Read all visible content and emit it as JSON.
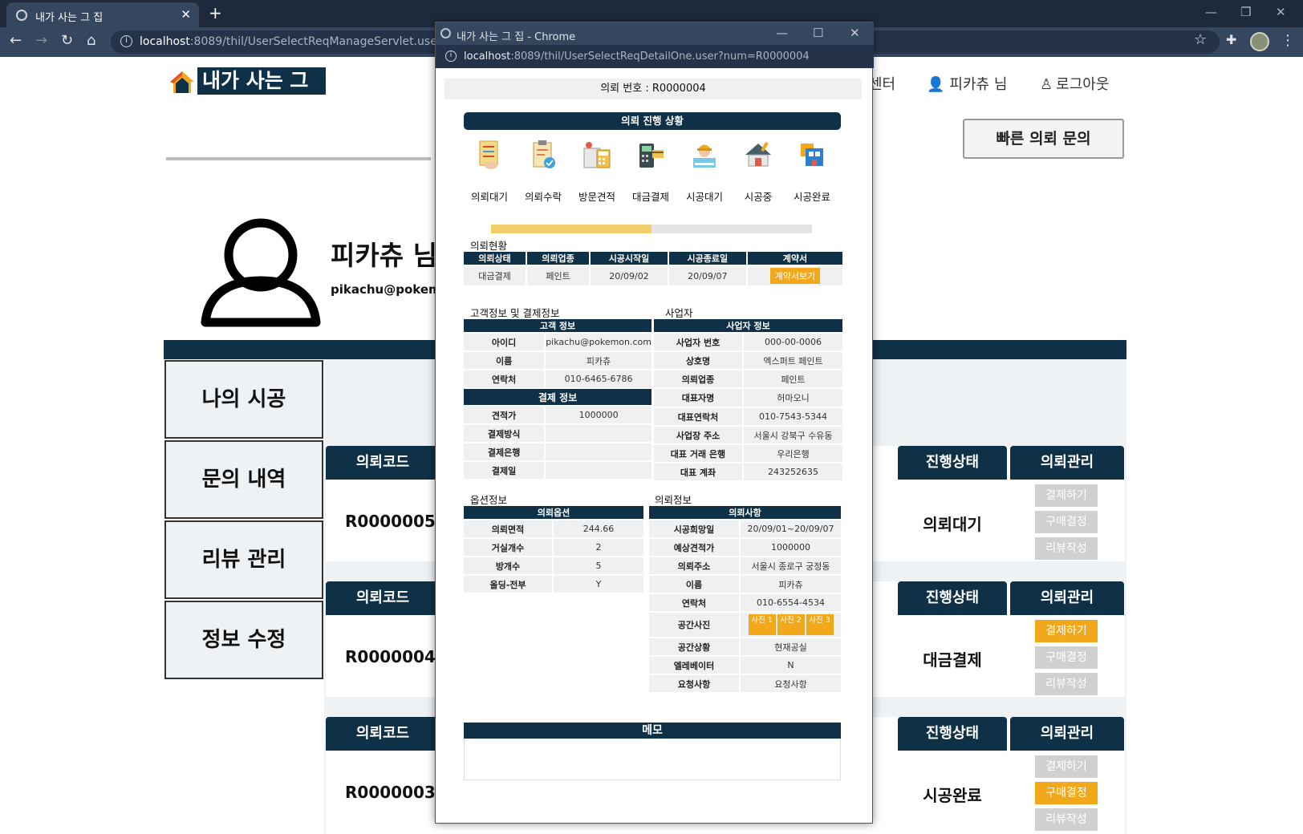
{
  "browser": {
    "tab_title": "내가 사는 그 집",
    "url_host": "localhost",
    "url_rest": ":8089/thil/UserSelectReqManageServlet.user"
  },
  "site": {
    "logo_text": "내가 사는 그 집",
    "nav_cs": "센터",
    "nav_user": "피카츄 님",
    "nav_logout": "로그아웃",
    "quick_button": "빠른 의뢰 문의"
  },
  "profile": {
    "name": "피카츄 님",
    "email": "pikachu@pokemo"
  },
  "sidebar": {
    "items": [
      {
        "label": "나의 시공"
      },
      {
        "label": "문의 내역"
      },
      {
        "label": "리뷰 관리"
      },
      {
        "label": "정보 수정"
      }
    ]
  },
  "list": {
    "col_code": "의뢰코드",
    "col_status": "진행상태",
    "col_manage": "의뢰관리",
    "rows": [
      {
        "code": "R0000005",
        "status": "의뢰대기",
        "actions": [
          {
            "label": "결제하기",
            "active": false
          },
          {
            "label": "구매결정",
            "active": false
          },
          {
            "label": "리뷰작성",
            "active": false
          }
        ]
      },
      {
        "code": "R0000004",
        "status": "대금결제",
        "actions": [
          {
            "label": "결제하기",
            "active": true
          },
          {
            "label": "구매결정",
            "active": false
          },
          {
            "label": "리뷰작성",
            "active": false
          }
        ]
      },
      {
        "code": "R0000003",
        "status": "시공완료",
        "actions": [
          {
            "label": "결제하기",
            "active": false
          },
          {
            "label": "구매결정",
            "active": true
          },
          {
            "label": "리뷰작성",
            "active": false
          }
        ]
      }
    ]
  },
  "popup": {
    "window_title": "내가 사는 그 집 - Chrome",
    "url_host": "localhost",
    "url_rest": ":8089/thil/UserSelectReqDetailOne.user?num=R0000004",
    "request_no": "의뢰 번호 : R0000004",
    "progress_title": "의뢰 진행 상황",
    "steps": [
      "의뢰대기",
      "의뢰수락",
      "방문견적",
      "대금결제",
      "시공대기",
      "시공중",
      "시공완료"
    ],
    "progress_fraction": 0.5,
    "status_section": "의뢰현황",
    "status_headers": [
      "의뢰상태",
      "의뢰업종",
      "시공시작일",
      "시공종료일",
      "계약서"
    ],
    "status_values": [
      "대금결제",
      "페인트",
      "20/09/02",
      "20/09/07"
    ],
    "contract_button": "계약서보기",
    "customer_section": "고객정보 및 결제정보",
    "biz_section": "사업자",
    "customer_header": "고객 정보",
    "customer_rows": [
      {
        "k": "아이디",
        "v": "pikachu@pokemon.com"
      },
      {
        "k": "이름",
        "v": "피카츄"
      },
      {
        "k": "연락처",
        "v": "010-6465-6786"
      }
    ],
    "payment_header": "결제 정보",
    "payment_rows": [
      {
        "k": "견적가",
        "v": "1000000"
      },
      {
        "k": "결제방식",
        "v": ""
      },
      {
        "k": "결제은행",
        "v": ""
      },
      {
        "k": "결제일",
        "v": ""
      }
    ],
    "biz_header": "사업자 정보",
    "biz_rows": [
      {
        "k": "사업자 번호",
        "v": "000-00-0006"
      },
      {
        "k": "상호명",
        "v": "엑스퍼트 페인트"
      },
      {
        "k": "의뢰업종",
        "v": "페인트"
      },
      {
        "k": "대표자명",
        "v": "허마오니"
      },
      {
        "k": "대표연락처",
        "v": "010-7543-5344"
      },
      {
        "k": "사업장 주소",
        "v": "서울시 강북구 수유동"
      },
      {
        "k": "대표 거래 은행",
        "v": "우리은행"
      },
      {
        "k": "대표 계좌",
        "v": "243252635"
      }
    ],
    "option_section": "옵션정보",
    "request_section": "의뢰정보",
    "option_header": "의뢰옵션",
    "option_rows": [
      {
        "k": "의뢰면적",
        "v": "244.66"
      },
      {
        "k": "거실개수",
        "v": "2"
      },
      {
        "k": "방개수",
        "v": "5"
      },
      {
        "k": "올딩-전부",
        "v": "Y"
      }
    ],
    "request_header": "의뢰사항",
    "request_rows": [
      {
        "k": "시공희망일",
        "v": "20/09/01~20/09/07"
      },
      {
        "k": "예상견적가",
        "v": "1000000"
      },
      {
        "k": "의뢰주소",
        "v": "서울시 종로구 궁정동"
      },
      {
        "k": "이름",
        "v": "피카츄"
      },
      {
        "k": "연락처",
        "v": "010-6554-4534"
      }
    ],
    "photo_label": "공간사진",
    "photos": [
      "사진 1",
      "사진 2",
      "사진 3"
    ],
    "request_rows2": [
      {
        "k": "공간상황",
        "v": "현재공실"
      },
      {
        "k": "엘레베이터",
        "v": "N"
      },
      {
        "k": "요청사항",
        "v": "요청사항"
      }
    ],
    "memo_header": "메모"
  }
}
